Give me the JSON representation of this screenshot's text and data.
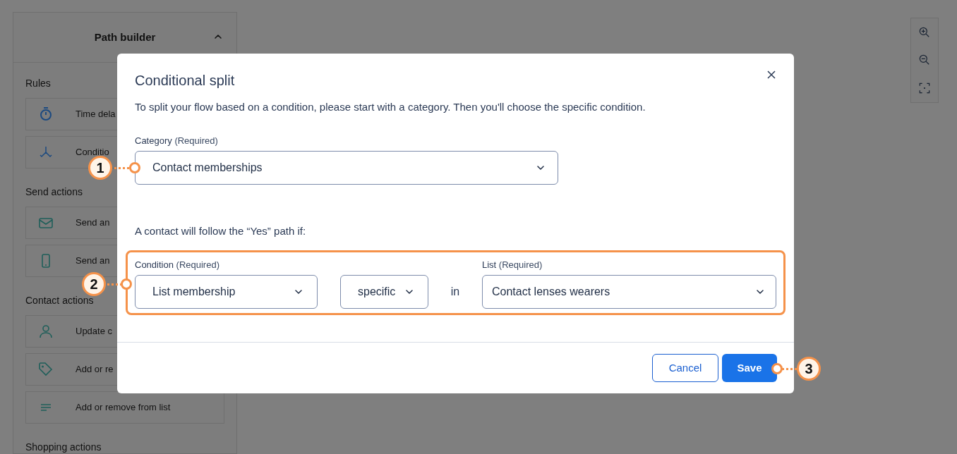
{
  "sidebar": {
    "title": "Path builder",
    "expanded": true,
    "sections": [
      {
        "heading": "Rules",
        "items": [
          {
            "kind": "timer",
            "label": "Time dela"
          },
          {
            "kind": "split",
            "label": "Conditio"
          }
        ]
      },
      {
        "heading": "Send actions",
        "items": [
          {
            "kind": "email",
            "label": "Send an"
          },
          {
            "kind": "phone",
            "label": "Send an"
          }
        ]
      },
      {
        "heading": "Contact actions",
        "items": [
          {
            "kind": "person",
            "label": "Update c"
          },
          {
            "kind": "tag",
            "label": "Add or re"
          },
          {
            "kind": "list",
            "label": "Add or remove from list"
          }
        ]
      },
      {
        "heading": "Shopping actions"
      }
    ]
  },
  "dialog": {
    "title": "Conditional split",
    "description": "To split your flow based on a condition, please start with a category. Then you'll choose the specific condition.",
    "category": {
      "label": "Category",
      "required": "(Required)",
      "value": "Contact memberships"
    },
    "condition_intro": "A contact will follow the “Yes” path if:",
    "condition": {
      "label": "Condition",
      "required": "(Required)",
      "value": "List membership"
    },
    "qualifier": {
      "value": "specific"
    },
    "connector": "in",
    "list": {
      "label": "List",
      "required": "(Required)",
      "value": "Contact lenses wearers"
    },
    "buttons": [
      {
        "kind": "secondary",
        "label": "Cancel"
      },
      {
        "kind": "primary",
        "label": "Save"
      }
    ]
  },
  "callouts": [
    "1",
    "2",
    "3"
  ]
}
